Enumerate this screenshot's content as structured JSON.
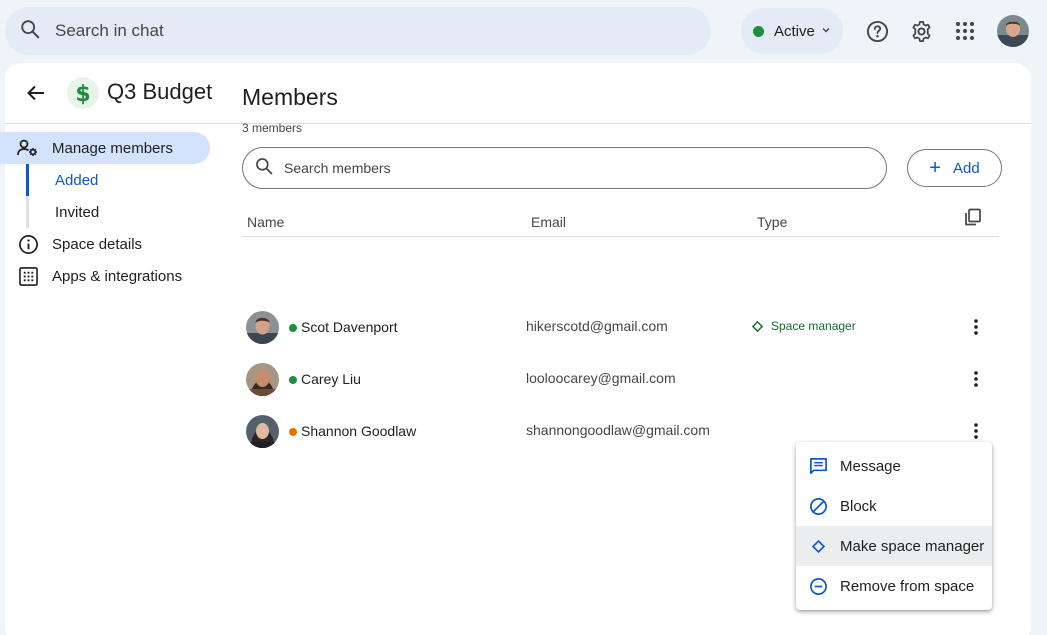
{
  "top_bar": {
    "search_placeholder": "Search in chat",
    "status_label": "Active",
    "status_color": "#1e8e3e",
    "icons": [
      "search-icon",
      "chevron-down-icon",
      "help-icon",
      "settings-icon",
      "apps-grid-icon",
      "user-avatar"
    ]
  },
  "header": {
    "space_title": "Q3 Budget",
    "space_emoji": "dollar-sign-icon"
  },
  "sidebar": {
    "manage_members": "Manage members",
    "added": "Added",
    "invited": "Invited",
    "space_details": "Space details",
    "apps_integrations": "Apps & integrations"
  },
  "members": {
    "title": "Members",
    "count": "3 members",
    "search_placeholder": "Search members",
    "add_label": "Add",
    "columns": {
      "name": "Name",
      "email": "Email",
      "type": "Type"
    },
    "rows": [
      {
        "name": "Scot Davenport",
        "email": "hikerscotd@gmail.com",
        "type": "Space manager",
        "presence_color": "#1e8e3e"
      },
      {
        "name": "Carey Liu",
        "email": "looloocarey@gmail.com",
        "type": "",
        "presence_color": "#1e8e3e"
      },
      {
        "name": "Shannon Goodlaw",
        "email": "shannongoodlaw@gmail.com",
        "type": "",
        "presence_color": "#e37400"
      }
    ]
  },
  "menu": {
    "items": [
      "Message",
      "Block",
      "Make space manager",
      "Remove from space"
    ],
    "highlighted": "Make space manager"
  },
  "colors": {
    "accent": "#0b57d0",
    "nav_active_bg": "#d3e3fd",
    "manager_green": "#146c2e"
  }
}
